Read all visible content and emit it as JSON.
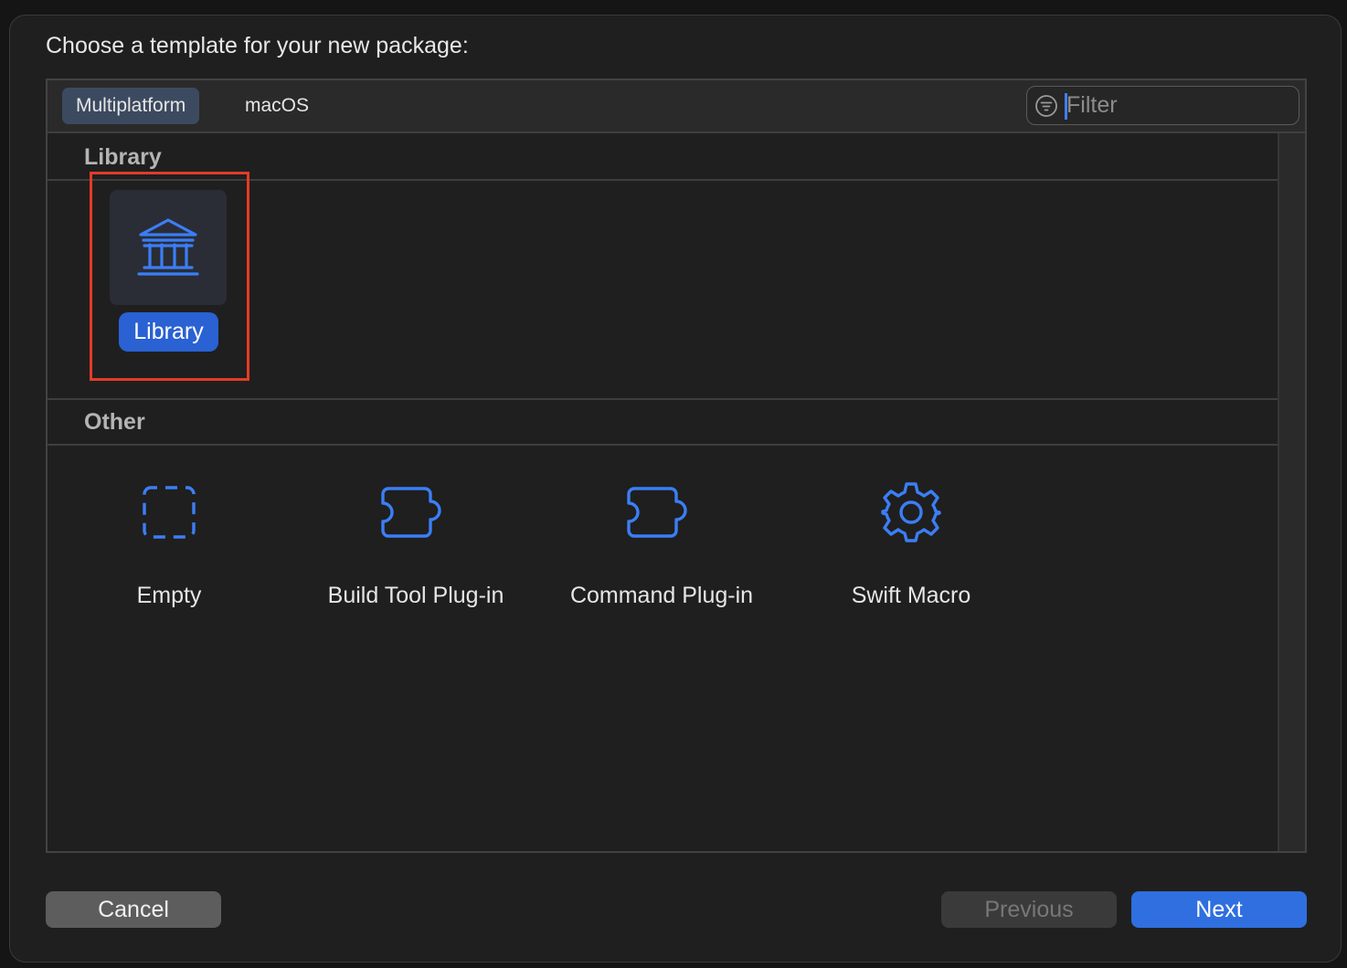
{
  "dialog": {
    "prompt": "Choose a template for your new package:"
  },
  "tabs": [
    {
      "label": "Multiplatform",
      "selected": true
    },
    {
      "label": "macOS",
      "selected": false
    }
  ],
  "filter": {
    "placeholder": "Filter",
    "value": ""
  },
  "sections": [
    {
      "title": "Library",
      "templates": [
        {
          "label": "Library",
          "icon": "library-columns-icon",
          "selected": true
        }
      ]
    },
    {
      "title": "Other",
      "templates": [
        {
          "label": "Empty",
          "icon": "dashed-square-icon"
        },
        {
          "label": "Build Tool Plug-in",
          "icon": "puzzle-piece-icon"
        },
        {
          "label": "Command Plug-in",
          "icon": "puzzle-piece-icon"
        },
        {
          "label": "Swift Macro",
          "icon": "gear-icon"
        }
      ]
    }
  ],
  "buttons": {
    "cancel": "Cancel",
    "previous": "Previous",
    "next": "Next"
  },
  "colors": {
    "accent": "#2f6fe0",
    "icon_blue": "#3b7ef6",
    "highlight_box": "#e53b28"
  }
}
